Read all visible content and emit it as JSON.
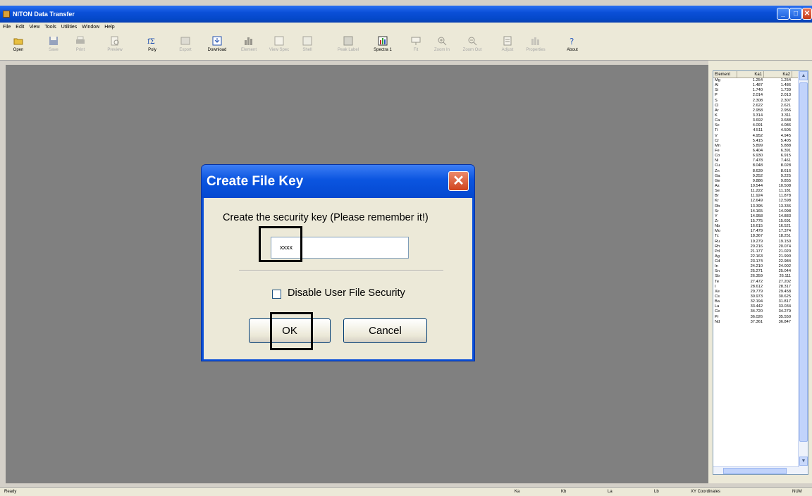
{
  "window": {
    "title": "NITON Data Transfer",
    "min": "_",
    "max": "□",
    "close": "✕"
  },
  "menu": [
    "File",
    "Edit",
    "View",
    "Tools",
    "Utilities",
    "Window",
    "Help"
  ],
  "toolbar": [
    {
      "label": "Open",
      "enabled": true,
      "icon": "open-folder-icon"
    },
    {
      "label": "Save",
      "enabled": false,
      "icon": "save-icon"
    },
    {
      "label": "Print",
      "enabled": false,
      "icon": "print-icon"
    },
    {
      "label": "Preview",
      "enabled": false,
      "icon": "preview-icon"
    },
    {
      "label": "Poly",
      "enabled": true,
      "icon": "poly-icon"
    },
    {
      "label": "Export",
      "enabled": false,
      "icon": "export-icon"
    },
    {
      "label": "Download",
      "enabled": true,
      "icon": "download-icon"
    },
    {
      "label": "Element",
      "enabled": false,
      "icon": "chart-icon"
    },
    {
      "label": "View Spec",
      "enabled": false,
      "icon": "view-spectra-icon"
    },
    {
      "label": "Shell",
      "enabled": false,
      "icon": "shell-icon"
    },
    {
      "label": "Peak Label",
      "enabled": false,
      "icon": "peak-label-icon"
    },
    {
      "label": "Spectra 1",
      "enabled": true,
      "icon": "spectra-icon"
    },
    {
      "label": "Fit",
      "enabled": false,
      "icon": "fit-icon"
    },
    {
      "label": "Zoom In",
      "enabled": false,
      "icon": "zoom-in-icon"
    },
    {
      "label": "Zoom Out",
      "enabled": false,
      "icon": "zoom-out-icon"
    },
    {
      "label": "Adjust",
      "enabled": false,
      "icon": "adjust-icon"
    },
    {
      "label": "Properties",
      "enabled": false,
      "icon": "properties-icon"
    },
    {
      "label": "About",
      "enabled": true,
      "icon": "about-icon"
    }
  ],
  "element_table": {
    "headers": [
      "Element",
      "Ka1",
      "Ka2"
    ],
    "rows": [
      [
        "Mg",
        "1.254",
        "1.254"
      ],
      [
        "Al",
        "1.487",
        "1.486"
      ],
      [
        "Si",
        "1.740",
        "1.739"
      ],
      [
        "P",
        "2.014",
        "2.013"
      ],
      [
        "S",
        "2.308",
        "2.307"
      ],
      [
        "Cl",
        "2.622",
        "2.621"
      ],
      [
        "Ar",
        "2.958",
        "2.956"
      ],
      [
        "K",
        "3.314",
        "3.311"
      ],
      [
        "Ca",
        "3.692",
        "3.688"
      ],
      [
        "Sc",
        "4.091",
        "4.086"
      ],
      [
        "Ti",
        "4.511",
        "4.505"
      ],
      [
        "V",
        "4.952",
        "4.945"
      ],
      [
        "Cr",
        "5.415",
        "5.405"
      ],
      [
        "Mn",
        "5.899",
        "5.888"
      ],
      [
        "Fe",
        "6.404",
        "6.391"
      ],
      [
        "Co",
        "6.930",
        "6.915"
      ],
      [
        "Ni",
        "7.478",
        "7.461"
      ],
      [
        "Cu",
        "8.048",
        "8.028"
      ],
      [
        "Zn",
        "8.639",
        "8.616"
      ],
      [
        "Ga",
        "9.252",
        "9.225"
      ],
      [
        "Ge",
        "9.886",
        "9.855"
      ],
      [
        "As",
        "10.544",
        "10.508"
      ],
      [
        "Se",
        "11.222",
        "11.181"
      ],
      [
        "Br",
        "11.924",
        "11.878"
      ],
      [
        "Kr",
        "12.649",
        "12.598"
      ],
      [
        "Rb",
        "13.395",
        "13.336"
      ],
      [
        "Sr",
        "14.165",
        "14.098"
      ],
      [
        "Y",
        "14.958",
        "14.883"
      ],
      [
        "Zr",
        "15.775",
        "15.691"
      ],
      [
        "Nb",
        "16.615",
        "16.521"
      ],
      [
        "Mo",
        "17.479",
        "17.374"
      ],
      [
        "Tc",
        "18.367",
        "18.251"
      ],
      [
        "Ru",
        "19.279",
        "19.150"
      ],
      [
        "Rh",
        "20.216",
        "20.074"
      ],
      [
        "Pd",
        "21.177",
        "21.020"
      ],
      [
        "Ag",
        "22.163",
        "21.990"
      ],
      [
        "Cd",
        "23.174",
        "22.984"
      ],
      [
        "In",
        "24.210",
        "24.002"
      ],
      [
        "Sn",
        "25.271",
        "25.044"
      ],
      [
        "Sb",
        "26.359",
        "26.111"
      ],
      [
        "Te",
        "27.472",
        "27.202"
      ],
      [
        "I",
        "28.612",
        "28.317"
      ],
      [
        "Xe",
        "29.779",
        "29.458"
      ],
      [
        "Cs",
        "30.973",
        "30.625"
      ],
      [
        "Ba",
        "32.194",
        "31.817"
      ],
      [
        "La",
        "33.442",
        "33.034"
      ],
      [
        "Ce",
        "34.720",
        "34.279"
      ],
      [
        "Pr",
        "36.026",
        "35.550"
      ],
      [
        "Nd",
        "37.361",
        "36.847"
      ]
    ]
  },
  "statusbar": {
    "ready": "Ready",
    "ka": "Ka",
    "kb": "Kb",
    "la": "La",
    "lb": "Lb",
    "coords": "XY Coordinates",
    "num": "NUM"
  },
  "dialog": {
    "title": "Create File Key",
    "close": "✕",
    "prompt": "Create the security key (Please remember it!)",
    "key_value": "xxxx",
    "checkbox_label": "Disable User File Security",
    "checkbox_checked": false,
    "ok_label": "OK",
    "cancel_label": "Cancel"
  }
}
